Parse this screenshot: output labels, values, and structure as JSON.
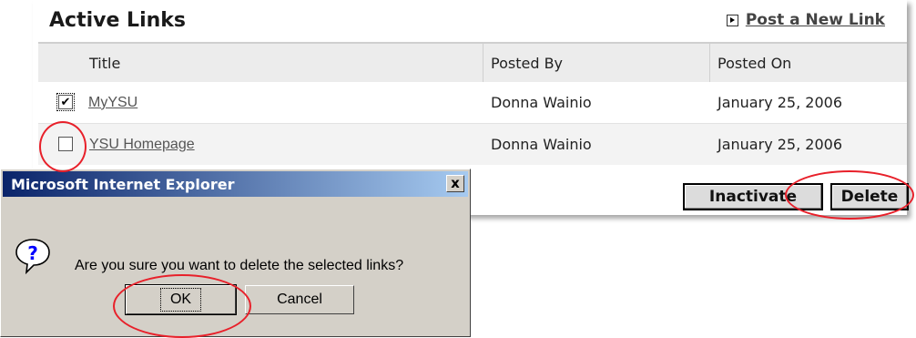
{
  "panel": {
    "title": "Active Links",
    "post_link": "Post a New Link",
    "columns": [
      "Title",
      "Posted By",
      "Posted On"
    ],
    "rows": [
      {
        "title": "MyYSU",
        "posted_by": "Donna Wainio",
        "posted_on": "January 25, 2006",
        "checked": true
      },
      {
        "title": "YSU Homepage",
        "posted_by": "Donna Wainio",
        "posted_on": "January 25, 2006",
        "checked": false
      }
    ],
    "buttons": {
      "inactivate": "Inactivate",
      "delete": "Delete"
    }
  },
  "dialog": {
    "title": "Microsoft Internet Explorer",
    "close_glyph": "x",
    "message": "Are you sure you want to delete the selected links?",
    "icon": "question-icon",
    "ok_label": "OK",
    "cancel_label": "Cancel"
  },
  "colors": {
    "annotation": "#e8202a",
    "titlebar_start": "#0a246a",
    "titlebar_end": "#a6caf0",
    "dialog_bg": "#d4d0c8"
  }
}
